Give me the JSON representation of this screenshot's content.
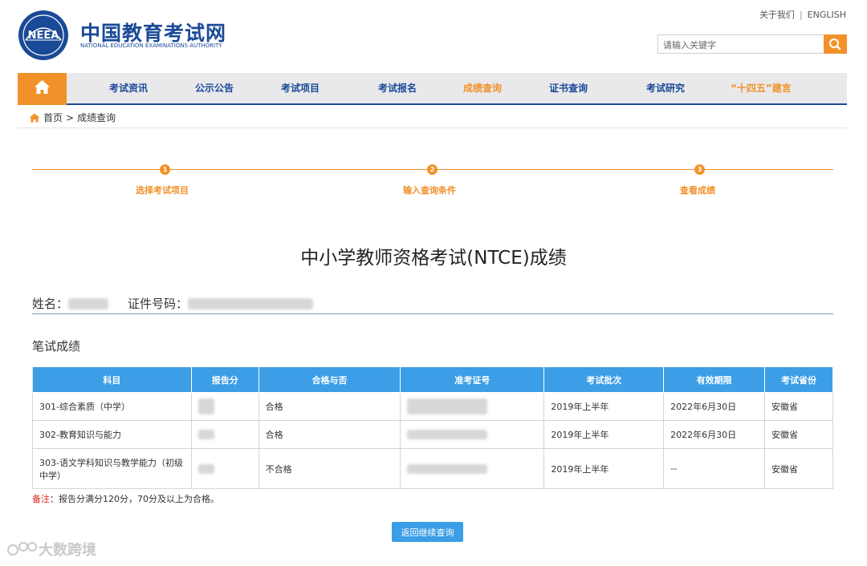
{
  "header": {
    "brand_cn": "中国教育考试网",
    "brand_en": "NATIONAL EDUCATION EXAMINATIONS AUTHORITY",
    "logo_text": "NEEA",
    "top_links": [
      "关于我们",
      "ENGLISH"
    ],
    "search_placeholder": "请输入关键字",
    "accent": "#f2912a",
    "brand_color": "#1a4a97"
  },
  "nav": {
    "items": [
      "考试资讯",
      "公示公告",
      "考试项目",
      "考试报名",
      "成绩查询",
      "证书查询",
      "考试研究",
      "“十四五”建言"
    ],
    "active": "成绩查询"
  },
  "breadcrumb": {
    "home": "首页",
    "separator": ">",
    "current": "成绩查询"
  },
  "steps": [
    {
      "num": "1",
      "label": "选择考试项目"
    },
    {
      "num": "2",
      "label": "输入查询条件"
    },
    {
      "num": "3",
      "label": "查看成绩"
    }
  ],
  "page_title": "中小学教师资格考试(NTCE)成绩",
  "person": {
    "name_label": "姓名：",
    "id_label": "证件号码："
  },
  "section_title": "笔试成绩",
  "table": {
    "headers": [
      "科目",
      "报告分",
      "合格与否",
      "准考证号",
      "考试批次",
      "有效期限",
      "考试省份"
    ],
    "rows": [
      {
        "subject": "301-综合素质（中学）",
        "result": "合格",
        "batch": "2019年上半年",
        "valid": "2022年6月30日",
        "province": "安徽省"
      },
      {
        "subject": "302-教育知识与能力",
        "result": "合格",
        "batch": "2019年上半年",
        "valid": "2022年6月30日",
        "province": "安徽省"
      },
      {
        "subject": "303-语文学科知识与教学能力（初级中学）",
        "result": "不合格",
        "batch": "2019年上半年",
        "valid": "--",
        "province": "安徽省"
      }
    ]
  },
  "note": {
    "label": "备注",
    "text": "：报告分满分120分，70分及以上为合格。"
  },
  "back_button": "返回继续查询",
  "watermark": "大数跨境"
}
